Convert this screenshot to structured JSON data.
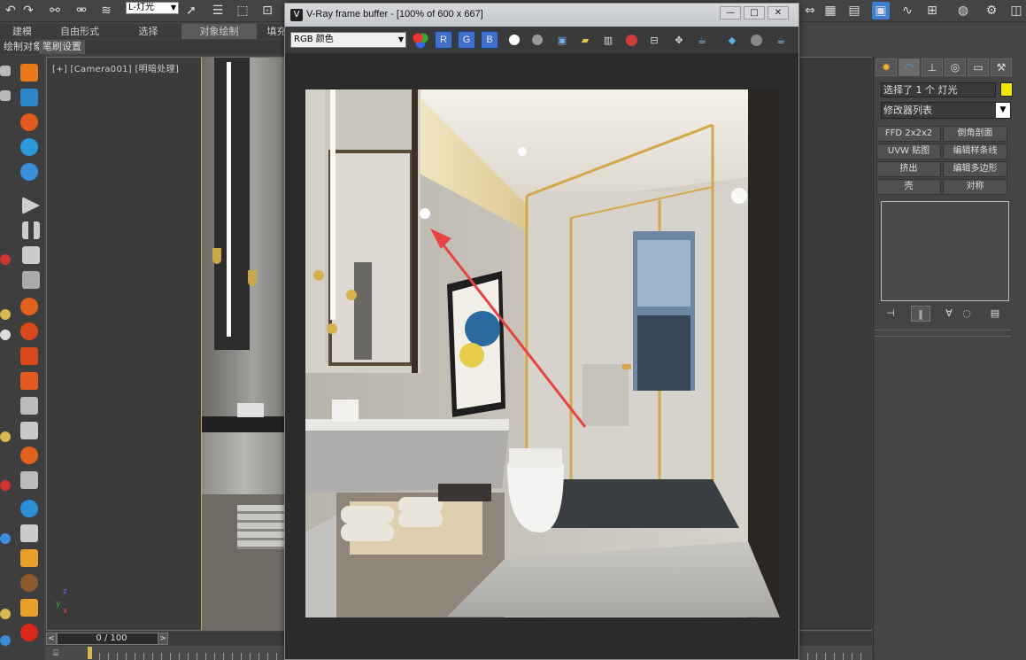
{
  "toolbar": {
    "layer_dropdown": "L-灯光",
    "icons": [
      "undo-icon",
      "redo-icon",
      "link-icon",
      "unlink-icon",
      "bind-space-warp-icon",
      "select-object-icon",
      "select-by-name-icon",
      "select-region-icon",
      "window-crossing-icon"
    ]
  },
  "ribbon": {
    "tabs": [
      "建模",
      "自由形式",
      "选择",
      "对象绘制",
      "填充"
    ],
    "active_tab": "对象绘制",
    "sub_items": [
      "绘制对象",
      "笔刷设置"
    ]
  },
  "viewport": {
    "label": "[+] [Camera001] [明暗处理]"
  },
  "time_slider": {
    "frame": "0 / 100",
    "prev": "<",
    "next": ">"
  },
  "command_panel": {
    "selection": "选择了 1 个 灯光",
    "color_swatch": "#f5e600",
    "modifier_list": "修改器列表",
    "buttons": [
      "FFD 2x2x2",
      "倒角剖面",
      "UVW 贴图",
      "编辑样条线",
      "挤出",
      "编辑多边形",
      "壳",
      "对称"
    ],
    "tab_icons": [
      "create-icon",
      "modify-icon",
      "hierarchy-icon",
      "motion-icon",
      "display-icon",
      "utilities-icon"
    ],
    "stack_tool_icons": [
      "pin-stack-icon",
      "show-end-result-icon",
      "make-unique-icon",
      "remove-modifier-icon",
      "configure-sets-icon"
    ]
  },
  "vfb": {
    "title": "V-Ray frame buffer - [100% of 600 x 667]",
    "channel": "RGB 颜色",
    "rgb_buttons": [
      "R",
      "G",
      "B"
    ],
    "win_buttons": [
      "—",
      "□",
      "✕"
    ],
    "tool_icons": [
      "color-mode-icon",
      "mono-white-icon",
      "mono-gray-icon",
      "save-icon",
      "load-icon",
      "duplicate-icon",
      "clear-icon",
      "region-icon",
      "track-mouse-icon",
      "teapot-render-icon",
      "lut-icon",
      "stop-render-icon",
      "render-icon"
    ]
  }
}
